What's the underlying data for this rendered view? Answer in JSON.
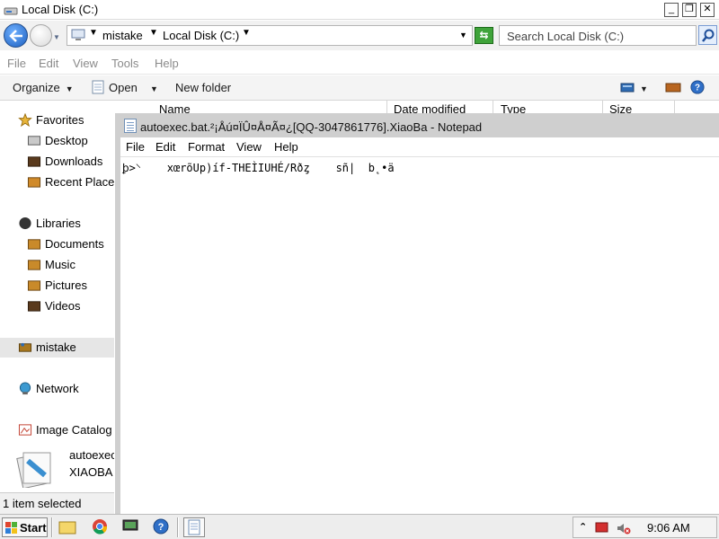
{
  "explorer": {
    "title": "Local Disk (C:)",
    "window_buttons": {
      "minimize": "_",
      "maximize": "❐",
      "close": "✕"
    },
    "breadcrumb": [
      "mistake",
      "Local Disk (C:)"
    ],
    "search_placeholder": "Search Local Disk (C:)",
    "menu": [
      "File",
      "Edit",
      "View",
      "Tools",
      "Help"
    ],
    "toolbar": {
      "organize": "Organize",
      "open": "Open",
      "new_folder": "New folder"
    },
    "columns": [
      "Name",
      "Date modified",
      "Type",
      "Size"
    ],
    "nav": {
      "favorites": "Favorites",
      "desktop": "Desktop",
      "downloads": "Downloads",
      "recent": "Recent Places",
      "libraries": "Libraries",
      "documents": "Documents",
      "music": "Music",
      "pictures": "Pictures",
      "videos": "Videos",
      "homegroup": "mistake",
      "network": "Network",
      "image_catalog": "Image Catalog"
    },
    "details": {
      "name": "autoexec",
      "type": "XIAOBA"
    },
    "status": "1 item selected"
  },
  "notepad": {
    "title": "autoexec.bat.²¡Åú¤ÏÛ¤Å¤Ã¤¿[QQ-3047861776].XiaoBa - Notepad",
    "menu": [
      "File",
      "Edit",
      "Format",
      "View",
      "Help"
    ],
    "content": "ꝧ>⸌    xœrõUp)íf-THEÌIUHÉ/Rðȥ    sñ|  b˛•ä"
  },
  "taskbar": {
    "start": "Start",
    "tray_up": "⌃",
    "clock": "9:06 AM"
  },
  "colors": {
    "accent": "#1c5fbf",
    "notepad_title": "#cfcfcf",
    "taskbar": "#ededed"
  }
}
